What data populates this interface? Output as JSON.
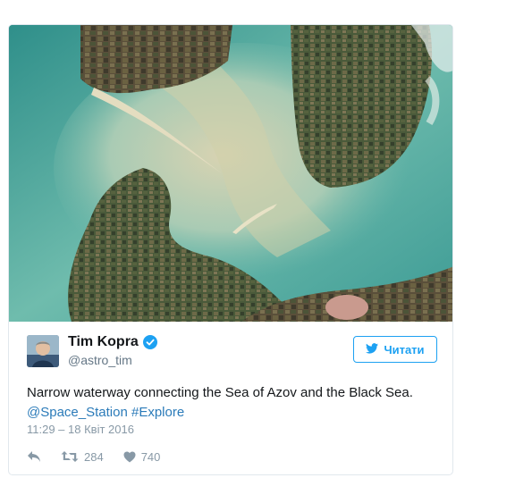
{
  "tweet": {
    "author_name": "Tim Kopra",
    "handle": "@astro_tim",
    "follow_label": "Читати",
    "text_main": "Narrow waterway connecting the Sea of Azov and the Black Sea.",
    "link_station": "@Space_Station",
    "link_hashtag": "#Explore",
    "timestamp": "11:29 – 18 Квіт 2016",
    "retweets": "284",
    "likes": "740"
  },
  "colors": {
    "accent": "#1da1f2",
    "link": "#2b7bb9",
    "meta": "#8899a6"
  },
  "icons": [
    "twitter-bird-icon",
    "verified-badge-icon",
    "reply-icon",
    "retweet-icon",
    "heart-icon"
  ]
}
